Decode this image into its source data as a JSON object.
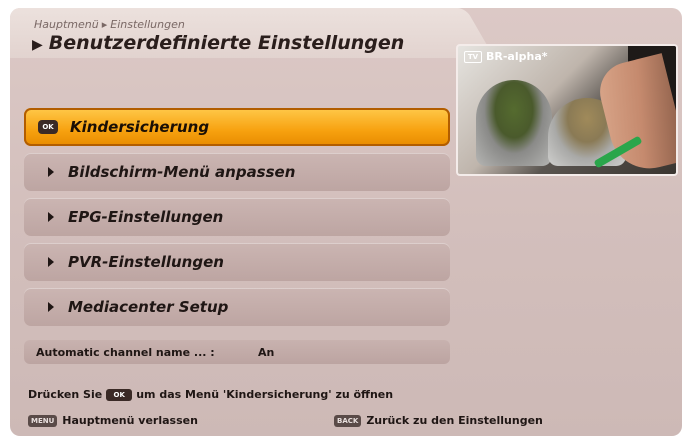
{
  "breadcrumb": {
    "root": "Hauptmenü",
    "separator": "▸",
    "current": "Einstellungen"
  },
  "title": "Benutzerdefinierte Einstellungen",
  "preview": {
    "channel": "BR-alpha*",
    "channel_icon": "tv-icon"
  },
  "menu": {
    "items": [
      {
        "label": "Kindersicherung",
        "selected": true
      },
      {
        "label": "Bildschirm-Menü anpassen",
        "selected": false
      },
      {
        "label": "EPG-Einstellungen",
        "selected": false
      },
      {
        "label": "PVR-Einstellungen",
        "selected": false
      },
      {
        "label": "Mediacenter Setup",
        "selected": false
      }
    ]
  },
  "info_row": {
    "name": "Automatic channel name ... :",
    "value": "An"
  },
  "hint": {
    "prefix": "Drücken Sie",
    "key": "OK",
    "suffix": "um das Menü 'Kindersicherung' zu öffnen"
  },
  "footer": {
    "left": {
      "key": "MENU",
      "label": "Hauptmenü verlassen"
    },
    "right": {
      "key": "BACK",
      "label": "Zurück zu den Einstellungen"
    }
  },
  "colors": {
    "accent": "#f7a10f",
    "panel": "#d3bfbc",
    "text": "#1f1614"
  }
}
